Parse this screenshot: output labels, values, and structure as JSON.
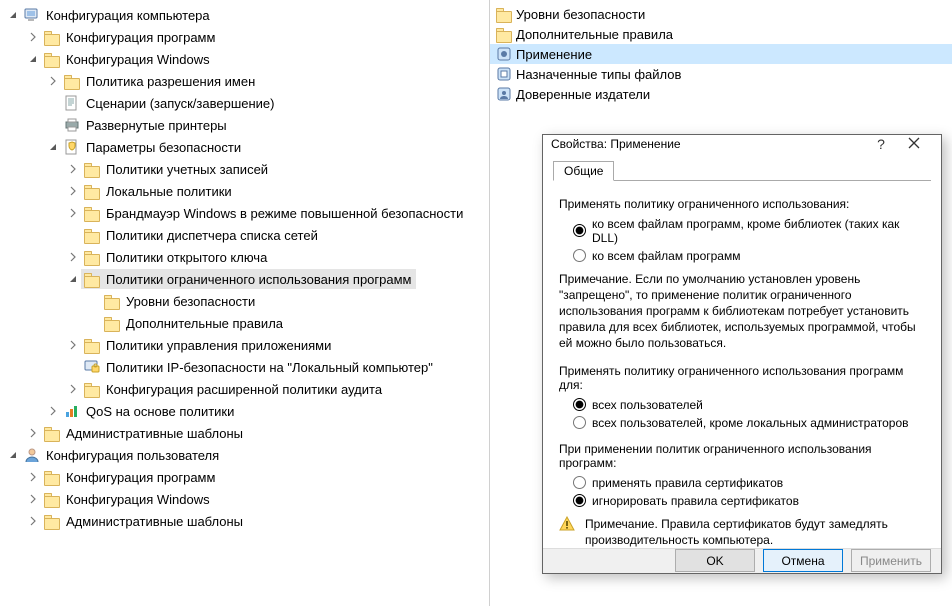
{
  "tree": [
    {
      "d": 0,
      "c": "open",
      "i": "pc",
      "t": "Конфигурация компьютера"
    },
    {
      "d": 1,
      "c": "closed",
      "i": "folder",
      "t": "Конфигурация программ"
    },
    {
      "d": 1,
      "c": "open",
      "i": "folder",
      "t": "Конфигурация Windows"
    },
    {
      "d": 2,
      "c": "closed",
      "i": "folder",
      "t": "Политика разрешения имен"
    },
    {
      "d": 2,
      "c": "none",
      "i": "script",
      "t": "Сценарии (запуск/завершение)"
    },
    {
      "d": 2,
      "c": "none",
      "i": "printer",
      "t": "Развернутые принтеры"
    },
    {
      "d": 2,
      "c": "open",
      "i": "security",
      "t": "Параметры безопасности"
    },
    {
      "d": 3,
      "c": "closed",
      "i": "folder",
      "t": "Политики учетных записей"
    },
    {
      "d": 3,
      "c": "closed",
      "i": "folder",
      "t": "Локальные политики"
    },
    {
      "d": 3,
      "c": "closed",
      "i": "folder",
      "t": "Брандмауэр Windows в режиме повышенной безопасности"
    },
    {
      "d": 3,
      "c": "none",
      "i": "folder",
      "t": "Политики диспетчера списка сетей"
    },
    {
      "d": 3,
      "c": "closed",
      "i": "folder",
      "t": "Политики открытого ключа"
    },
    {
      "d": 3,
      "c": "open",
      "i": "folder",
      "t": "Политики ограниченного использования программ",
      "sel": true
    },
    {
      "d": 4,
      "c": "none",
      "i": "folder",
      "t": "Уровни безопасности"
    },
    {
      "d": 4,
      "c": "none",
      "i": "folder",
      "t": "Дополнительные правила"
    },
    {
      "d": 3,
      "c": "closed",
      "i": "folder",
      "t": "Политики управления приложениями"
    },
    {
      "d": 3,
      "c": "none",
      "i": "ipsec",
      "t": "Политики IP-безопасности на \"Локальный компьютер\""
    },
    {
      "d": 3,
      "c": "closed",
      "i": "folder",
      "t": "Конфигурация расширенной политики аудита"
    },
    {
      "d": 2,
      "c": "closed",
      "i": "qos",
      "t": "QoS на основе политики"
    },
    {
      "d": 1,
      "c": "closed",
      "i": "folder",
      "t": "Административные шаблоны"
    },
    {
      "d": 0,
      "c": "open",
      "i": "user",
      "t": "Конфигурация пользователя"
    },
    {
      "d": 1,
      "c": "closed",
      "i": "folder",
      "t": "Конфигурация программ"
    },
    {
      "d": 1,
      "c": "closed",
      "i": "folder",
      "t": "Конфигурация Windows"
    },
    {
      "d": 1,
      "c": "closed",
      "i": "folder",
      "t": "Административные шаблоны"
    }
  ],
  "list": [
    {
      "i": "folder",
      "t": "Уровни безопасности"
    },
    {
      "i": "folder",
      "t": "Дополнительные правила"
    },
    {
      "i": "enforce",
      "t": "Применение",
      "sel": true
    },
    {
      "i": "types",
      "t": "Назначенные типы файлов"
    },
    {
      "i": "publishers",
      "t": "Доверенные издатели"
    }
  ],
  "dialog": {
    "title": "Свойства: Применение",
    "tab": "Общие",
    "h1": "Применять политику ограниченного использования:",
    "r1a": "ко всем файлам программ, кроме библиотек (таких как DLL)",
    "r1b": "ко всем файлам программ",
    "note1": "Примечание. Если по умолчанию установлен уровень \"запрещено\", то применение политик ограниченного использования программ к библиотекам потребует установить правила для всех библиотек, используемых программой, чтобы ей можно было пользоваться.",
    "h2": "Применять политику ограниченного использования программ для:",
    "r2a": "всех пользователей",
    "r2b": "всех пользователей, кроме локальных администраторов",
    "h3": "При применении политик ограниченного использования программ:",
    "r3a": "применять правила сертификатов",
    "r3b": "игнорировать правила сертификатов",
    "note2": "Примечание. Правила сертификатов будут замедлять производительность компьютера.",
    "btn_ok": "OK",
    "btn_cancel": "Отмена",
    "btn_apply": "Применить"
  }
}
